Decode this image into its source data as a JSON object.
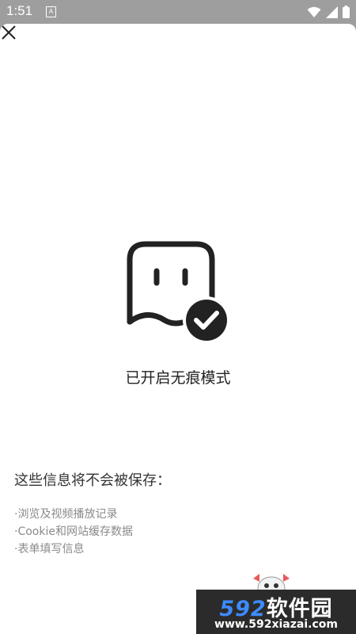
{
  "status_bar": {
    "time": "1:51",
    "notification_letter": "A",
    "icons": [
      "a-notification-icon",
      "wifi-icon",
      "signal-icon",
      "battery-icon"
    ]
  },
  "header": {
    "close_icon": "close-icon"
  },
  "main": {
    "illustration_icon": "incognito-ghost-check-icon",
    "title": "已开启无痕模式",
    "info_heading": "这些信息将不会被保存：",
    "info_items": [
      {
        "bullet": "·",
        "text": "浏览及视频播放记录"
      },
      {
        "bullet": "·",
        "text": "Cookie和网站缓存数据"
      },
      {
        "bullet": "·",
        "text": "表单填写信息"
      }
    ]
  },
  "watermark": {
    "number": "592",
    "brand": "软件园",
    "url": "www.592xiazai.com"
  },
  "colors": {
    "status_bar": "#9e9e9e",
    "background": "#ffffff",
    "icon": "#222222",
    "title_text": "#222222",
    "secondary_text": "#8a8a8a",
    "watermark_blue": "#3d8bff",
    "watermark_bg": "#2b2b2b"
  }
}
